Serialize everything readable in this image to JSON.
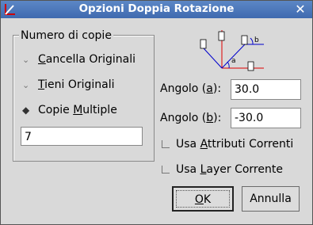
{
  "window": {
    "title": "Opzioni Doppia Rotazione",
    "close_glyph": "✕"
  },
  "group": {
    "title": "Numero di copie"
  },
  "radios": [
    {
      "pre": "",
      "u": "C",
      "post": "ancella Originali",
      "selected": false
    },
    {
      "pre": "",
      "u": "T",
      "post": "ieni Originali",
      "selected": false
    },
    {
      "pre": "Copie ",
      "u": "M",
      "post": "ultiple",
      "selected": true
    }
  ],
  "copies": {
    "value": "7"
  },
  "diagram": {
    "label_a": "a",
    "label_b": "b"
  },
  "angles": {
    "a": {
      "pre": "Angolo (",
      "u": "a",
      "post": "):",
      "value": "30.0"
    },
    "b": {
      "pre": "Angolo (",
      "u": "b",
      "post": "):",
      "value": "-30.0"
    }
  },
  "checks": [
    {
      "pre": "Usa ",
      "u": "A",
      "post": "ttributi Correnti",
      "checked": false
    },
    {
      "pre": "Usa ",
      "u": "L",
      "post": "ayer Corrente",
      "checked": false
    }
  ],
  "buttons": {
    "ok": {
      "u": "O",
      "post": "K"
    },
    "cancel": "Annulla"
  },
  "colors": {
    "titlebar": "#4a76bb",
    "diagram_red": "#e00000",
    "diagram_blue": "#0000cc"
  }
}
